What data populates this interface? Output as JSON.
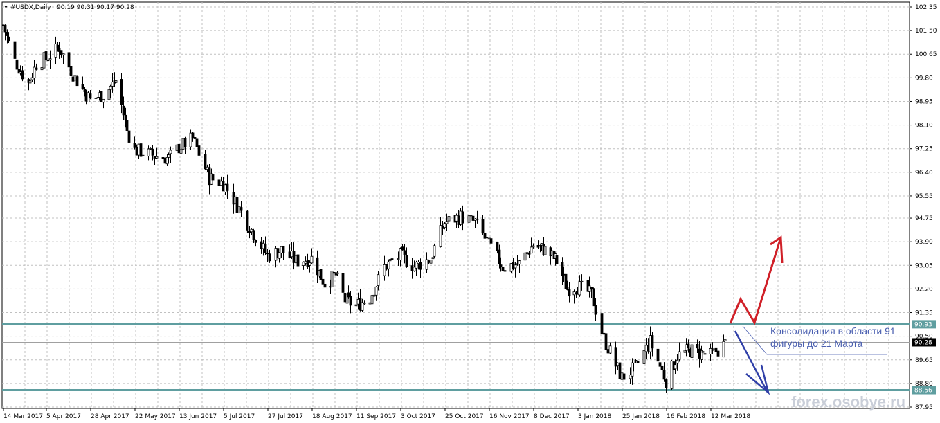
{
  "chart_header": {
    "symbol_timeframe": "#USDX,Daily",
    "ohlc": "90.19 90.31 90.17 90.28"
  },
  "chart_data": {
    "type": "candlestick",
    "ylim": [
      87.95,
      102.35
    ],
    "y_ticks": [
      "102.35",
      "101.50",
      "100.65",
      "99.80",
      "98.95",
      "98.10",
      "97.25",
      "96.40",
      "95.55",
      "94.75",
      "93.90",
      "93.05",
      "92.20",
      "91.35",
      "90.50",
      "89.65",
      "88.80",
      "87.95"
    ],
    "x_ticks": [
      "14 Mar 2017",
      "5 Apr 2017",
      "28 Apr 2017",
      "22 May 2017",
      "13 Jun 2017",
      "5 Jul 2017",
      "27 Jul 2017",
      "18 Aug 2017",
      "11 Sep 2017",
      "3 Oct 2017",
      "25 Oct 2017",
      "16 Nov 2017",
      "8 Dec 2017",
      "3 Jan 2018",
      "25 Jan 2018",
      "16 Feb 2018",
      "12 Mar 2018"
    ],
    "close_path": [
      [
        "14 Mar 2017",
        101.7
      ],
      [
        "20 Mar 2017",
        100.4
      ],
      [
        "27 Mar 2017",
        99.6
      ],
      [
        "31 Mar 2017",
        100.3
      ],
      [
        "5 Apr 2017",
        100.5
      ],
      [
        "12 Apr 2017",
        100.9
      ],
      [
        "20 Apr 2017",
        99.8
      ],
      [
        "28 Apr 2017",
        99.0
      ],
      [
        "5 May 2017",
        99.2
      ],
      [
        "12 May 2017",
        99.7
      ],
      [
        "18 May 2017",
        97.9
      ],
      [
        "22 May 2017",
        97.2
      ],
      [
        "1 Jun 2017",
        97.0
      ],
      [
        "8 Jun 2017",
        96.9
      ],
      [
        "13 Jun 2017",
        97.3
      ],
      [
        "20 Jun 2017",
        97.6
      ],
      [
        "28 Jun 2017",
        96.2
      ],
      [
        "5 Jul 2017",
        96.0
      ],
      [
        "13 Jul 2017",
        95.1
      ],
      [
        "20 Jul 2017",
        94.2
      ],
      [
        "27 Jul 2017",
        93.4
      ],
      [
        "3 Aug 2017",
        93.6
      ],
      [
        "10 Aug 2017",
        93.2
      ],
      [
        "18 Aug 2017",
        93.3
      ],
      [
        "25 Aug 2017",
        92.4
      ],
      [
        "31 Aug 2017",
        92.7
      ],
      [
        "5 Sep 2017",
        91.8
      ],
      [
        "11 Sep 2017",
        91.6
      ],
      [
        "18 Sep 2017",
        91.9
      ],
      [
        "25 Sep 2017",
        93.0
      ],
      [
        "3 Oct 2017",
        93.4
      ],
      [
        "10 Oct 2017",
        93.0
      ],
      [
        "18 Oct 2017",
        93.3
      ],
      [
        "25 Oct 2017",
        94.6
      ],
      [
        "2 Nov 2017",
        94.8
      ],
      [
        "9 Nov 2017",
        94.6
      ],
      [
        "16 Nov 2017",
        93.8
      ],
      [
        "23 Nov 2017",
        93.0
      ],
      [
        "1 Dec 2017",
        93.1
      ],
      [
        "8 Dec 2017",
        93.8
      ],
      [
        "15 Dec 2017",
        93.6
      ],
      [
        "22 Dec 2017",
        93.2
      ],
      [
        "28 Dec 2017",
        92.2
      ],
      [
        "3 Jan 2018",
        92.3
      ],
      [
        "10 Jan 2018",
        92.0
      ],
      [
        "16 Jan 2018",
        90.4
      ],
      [
        "25 Jan 2018",
        89.0
      ],
      [
        "1 Feb 2018",
        89.4
      ],
      [
        "8 Feb 2018",
        90.3
      ],
      [
        "16 Feb 2018",
        88.9
      ],
      [
        "22 Feb 2018",
        89.8
      ],
      [
        "1 Mar 2018",
        90.0
      ],
      [
        "12 Mar 2018",
        89.8
      ],
      [
        "21 Mar 2018",
        90.28
      ]
    ],
    "levels": [
      {
        "value": 90.93,
        "label": "90.93",
        "color": "#5f9ea0"
      },
      {
        "value": 88.56,
        "label": "88.56",
        "color": "#5f9ea0"
      }
    ],
    "current_price": {
      "value": 90.28,
      "label": "90.28"
    },
    "colors": {
      "candle": "#000000",
      "bull_highlight": "#00b050",
      "grid": "#c0c0c0",
      "up_arrow": "#d02028",
      "down_arrow": "#3040a8"
    }
  },
  "annotation": {
    "line1": "Консолидация в области 91",
    "line2": "фигуры до 21 Марта"
  },
  "watermark": "forex.osobye.ru"
}
